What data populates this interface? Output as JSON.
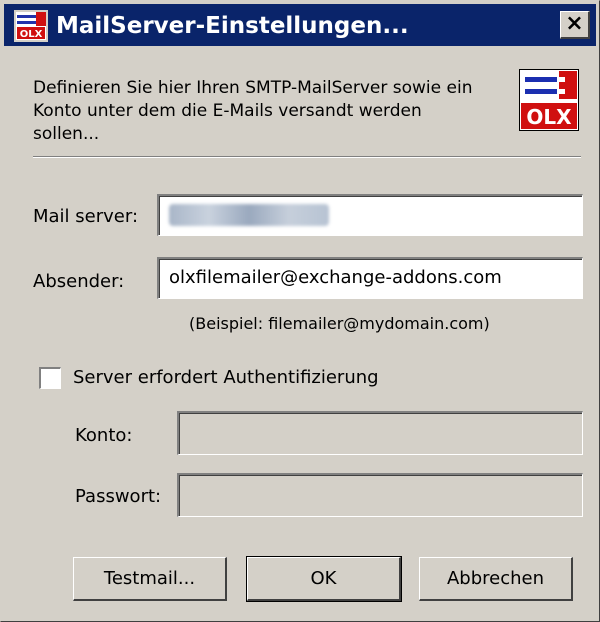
{
  "window": {
    "title": "MailServer-Einstellungen...",
    "close_label": "×",
    "colors": {
      "titlebar": "#0a246a",
      "face": "#d4d0c8"
    }
  },
  "description": "Definieren Sie hier Ihren SMTP-MailServer sowie ein Konto unter dem die E-Mails versandt werden sollen...",
  "logo": {
    "text": "OLX",
    "icon": "olx-plug-icon"
  },
  "form": {
    "mail_server_label": "Mail server:",
    "mail_server_value": "",
    "absender_label": "Absender:",
    "absender_value": "olxfilemailer@exchange-addons.com",
    "example_hint": "(Beispiel: filemailer@mydomain.com)",
    "auth_checkbox_label": "Server erfordert Authentifizierung",
    "auth_checked": false,
    "konto_label": "Konto:",
    "konto_value": "",
    "passwort_label": "Passwort:",
    "passwort_value": ""
  },
  "buttons": {
    "testmail": "Testmail...",
    "ok": "OK",
    "cancel": "Abbrechen"
  }
}
